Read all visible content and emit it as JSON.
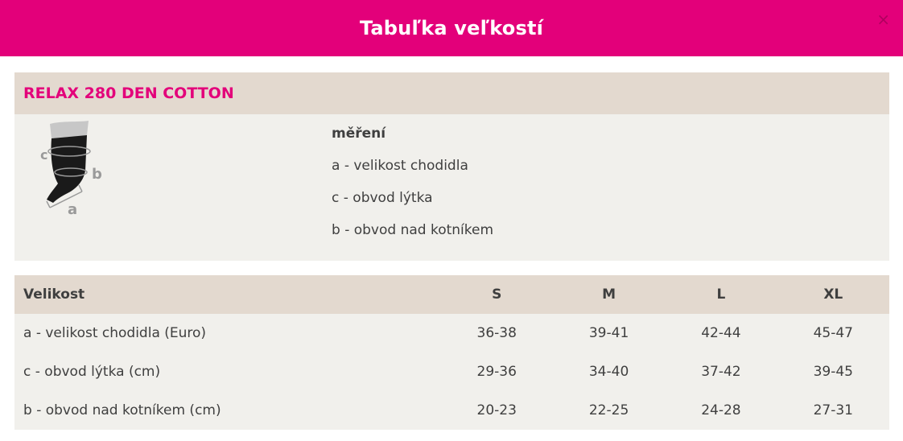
{
  "modal": {
    "title": "Tabuľka veľkostí",
    "close_symbol": "×"
  },
  "product": {
    "name": "RELAX 280 DEN COTTON",
    "diagram_labels": {
      "a": "a",
      "b": "b",
      "c": "c"
    }
  },
  "measurements": {
    "heading": "měření",
    "items": [
      "a - velikost chodidla",
      "c - obvod lýtka",
      "b - obvod nad kotníkem"
    ]
  },
  "size_table": {
    "header": [
      "Velikost",
      "S",
      "M",
      "L",
      "XL"
    ],
    "rows": [
      [
        "a - velikost chodidla (Euro)",
        "36-38",
        "39-41",
        "42-44",
        "45-47"
      ],
      [
        "c - obvod lýtka (cm)",
        "29-36",
        "34-40",
        "37-42",
        "39-45"
      ],
      [
        "b - obvod nad kotníkem (cm)",
        "20-23",
        "22-25",
        "24-28",
        "27-31"
      ]
    ]
  },
  "colors": {
    "accent": "#e3007a",
    "band": "#e3d9cf",
    "panel": "#f1f0ec",
    "text": "#3f3f3f"
  },
  "icons": [
    "close-icon",
    "sock-diagram-icon"
  ]
}
